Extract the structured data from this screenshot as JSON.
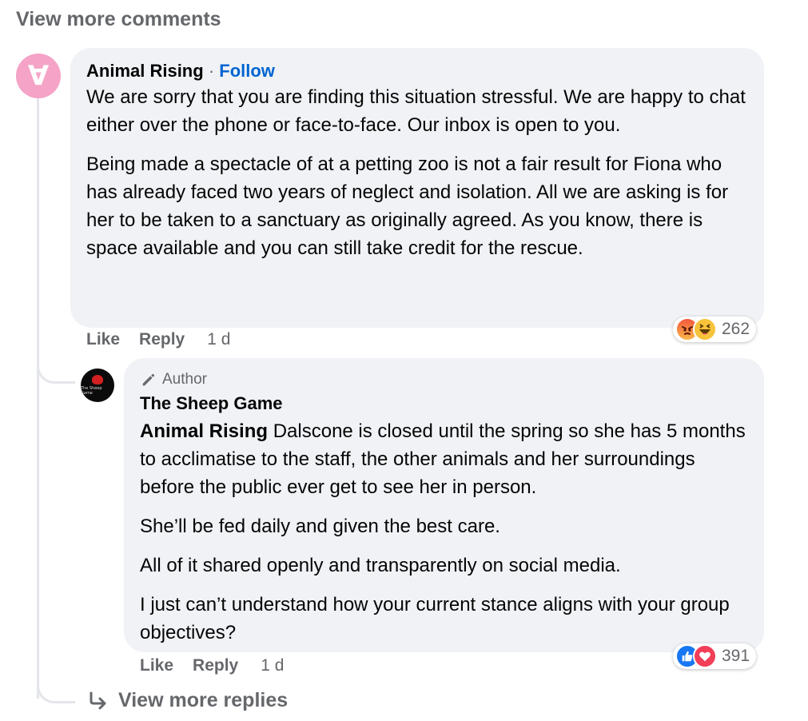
{
  "header": {
    "view_more_comments": "View more comments"
  },
  "comment1": {
    "author": "Animal Rising",
    "separator": "·",
    "follow_label": "Follow",
    "avatar_glyph": "∀",
    "paragraphs": [
      "We are sorry that you are finding this situation stressful. We are happy to chat either over the phone or face-to-face. Our inbox is open to you.",
      "Being made a spectacle of at a petting zoo is not a fair result for Fiona who has already faced two years of neglect and isolation. All we are asking is for her to be taken to a sanctuary as originally agreed. As you know, there is space available and you can still take credit for the rescue."
    ],
    "actions": {
      "like": "Like",
      "reply": "Reply",
      "time": "1 d"
    },
    "reactions": {
      "icons": [
        "angry-emoji-icon",
        "haha-emoji-icon"
      ],
      "count": "262"
    }
  },
  "reply1": {
    "badge": "Author",
    "author": "The Sheep Game",
    "avatar_logo_text": "The Sheep Game",
    "mention": "Animal Rising",
    "paragraphs": [
      "Dalscone is closed until the spring so she has 5 months to acclimatise to the staff, the other animals and her surroundings before the public ever get to see her in person.",
      "She’ll be fed daily and given the best care.",
      "All of it shared openly and transparently on social media.",
      "I just can’t understand how your current stance aligns with your group objectives?"
    ],
    "actions": {
      "like": "Like",
      "reply": "Reply",
      "time": "1 d"
    },
    "reactions": {
      "icons": [
        "like-reaction-icon",
        "love-reaction-icon"
      ],
      "count": "391"
    }
  },
  "footer": {
    "view_more_replies": "View more replies"
  },
  "colors": {
    "link_blue": "#0064d1",
    "bubble_bg": "#f0f2f5",
    "muted_text": "#65676b",
    "avatar_pink": "#f5a3c7"
  }
}
